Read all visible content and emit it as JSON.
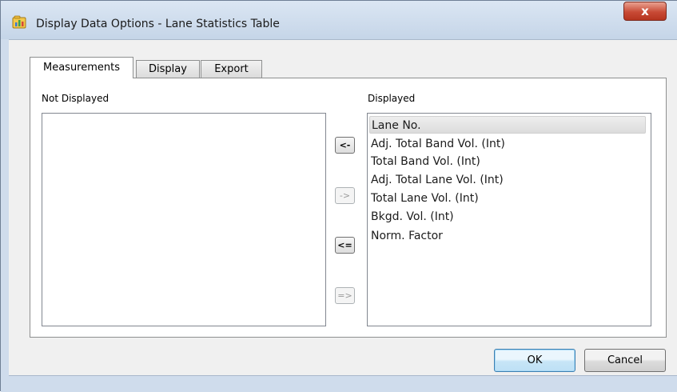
{
  "window": {
    "title": "Display Data Options - Lane Statistics Table",
    "app_icon": "chart-app-icon",
    "close_label": "x"
  },
  "tabs": [
    {
      "label": "Measurements",
      "active": true
    },
    {
      "label": "Display",
      "active": false
    },
    {
      "label": "Export",
      "active": false
    }
  ],
  "measurements": {
    "not_displayed_label": "Not Displayed",
    "displayed_label": "Displayed",
    "not_displayed_items": [],
    "displayed_items": [
      "Lane No.",
      "Adj. Total Band Vol. (Int)",
      "Total Band Vol. (Int)",
      "Adj. Total Lane Vol. (Int)",
      "Total Lane Vol. (Int)",
      "Bkgd. Vol. (Int)",
      "Norm. Factor"
    ],
    "selected_item": "Lane No.",
    "move_buttons": {
      "move_left": "<-",
      "move_right": "->",
      "move_all_left": "<=",
      "move_all_right": "=>"
    }
  },
  "buttons": {
    "ok": "OK",
    "cancel": "Cancel"
  },
  "colors": {
    "frame": "#cfdcec",
    "close_button": "#c84a35",
    "default_button_border": "#3c7fb1",
    "selection": "#dcdcdc"
  }
}
